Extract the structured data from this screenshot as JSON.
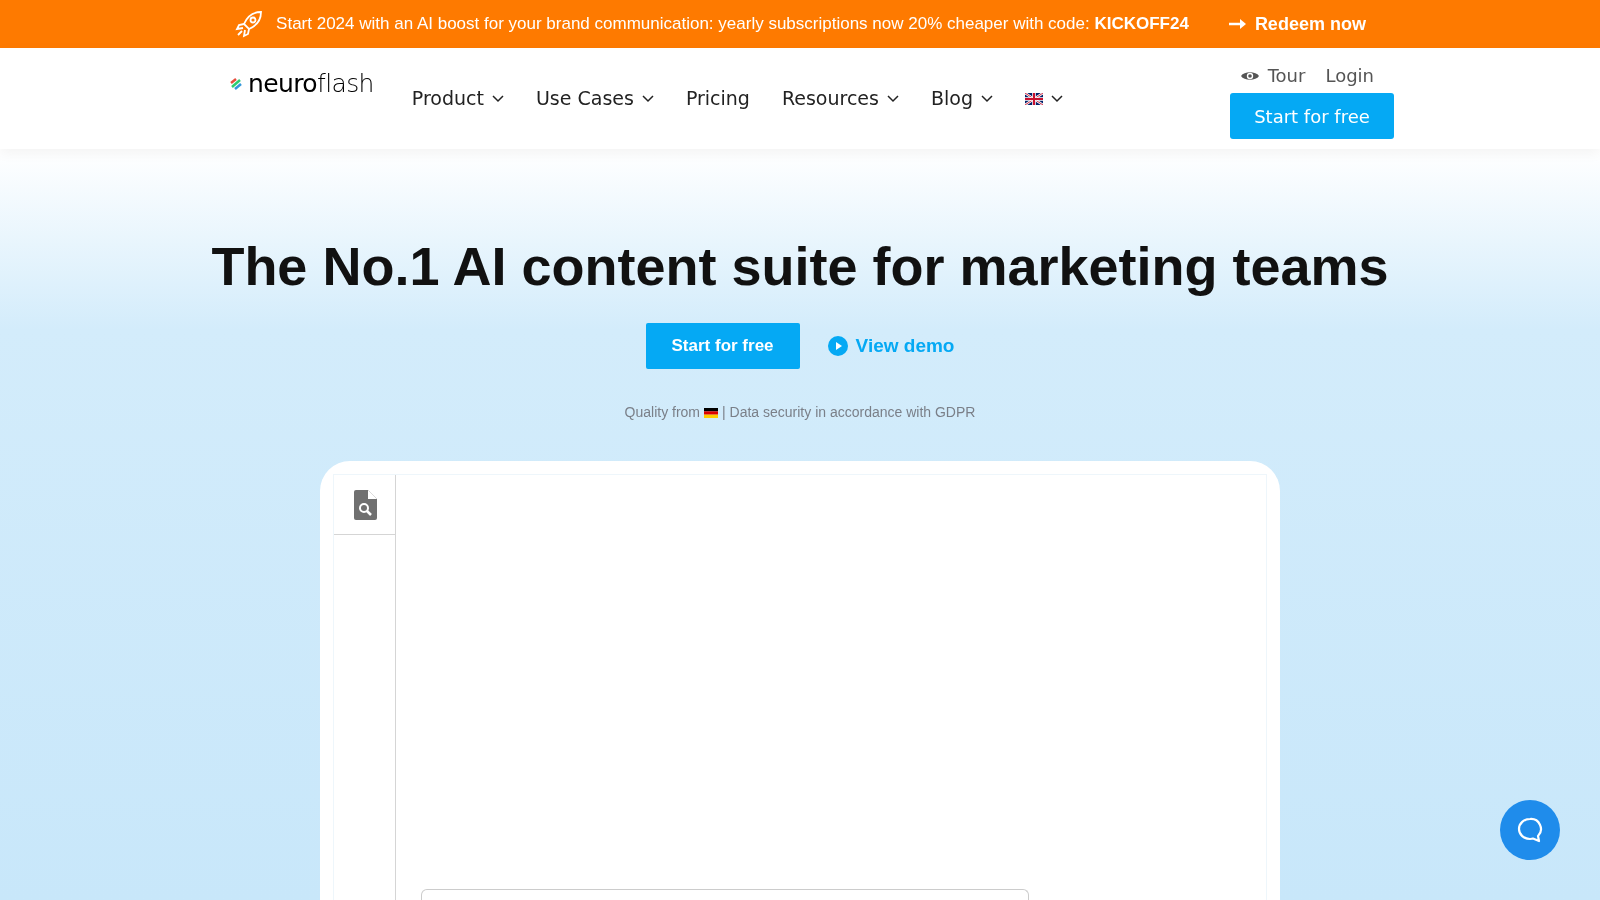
{
  "banner": {
    "text": "Start 2024 with an AI boost for your brand communication: yearly subscriptions now 20% cheaper with code: **KICKOFF24**",
    "link": "Redeem now"
  },
  "header": {
    "logo": "**neuro**flash",
    "nav": [
      {
        "kind": "dropdown",
        "label": "Product"
      },
      {
        "kind": "dropdown",
        "label": "Use Cases"
      },
      {
        "kind": "link",
        "label": "Pricing"
      },
      {
        "kind": "dropdown",
        "label": "Resources"
      },
      {
        "kind": "dropdown",
        "label": "Blog"
      },
      {
        "kind": "language"
      }
    ],
    "tour": "Tour",
    "login": "Login",
    "cta": "Start for free"
  },
  "hero": {
    "title": "The No.1 AI content suite for marketing teams",
    "primary": "Start for free",
    "secondary": "View demo",
    "note_before": "Quality from",
    "note_after": "| Data security in accordance with GDPR"
  }
}
